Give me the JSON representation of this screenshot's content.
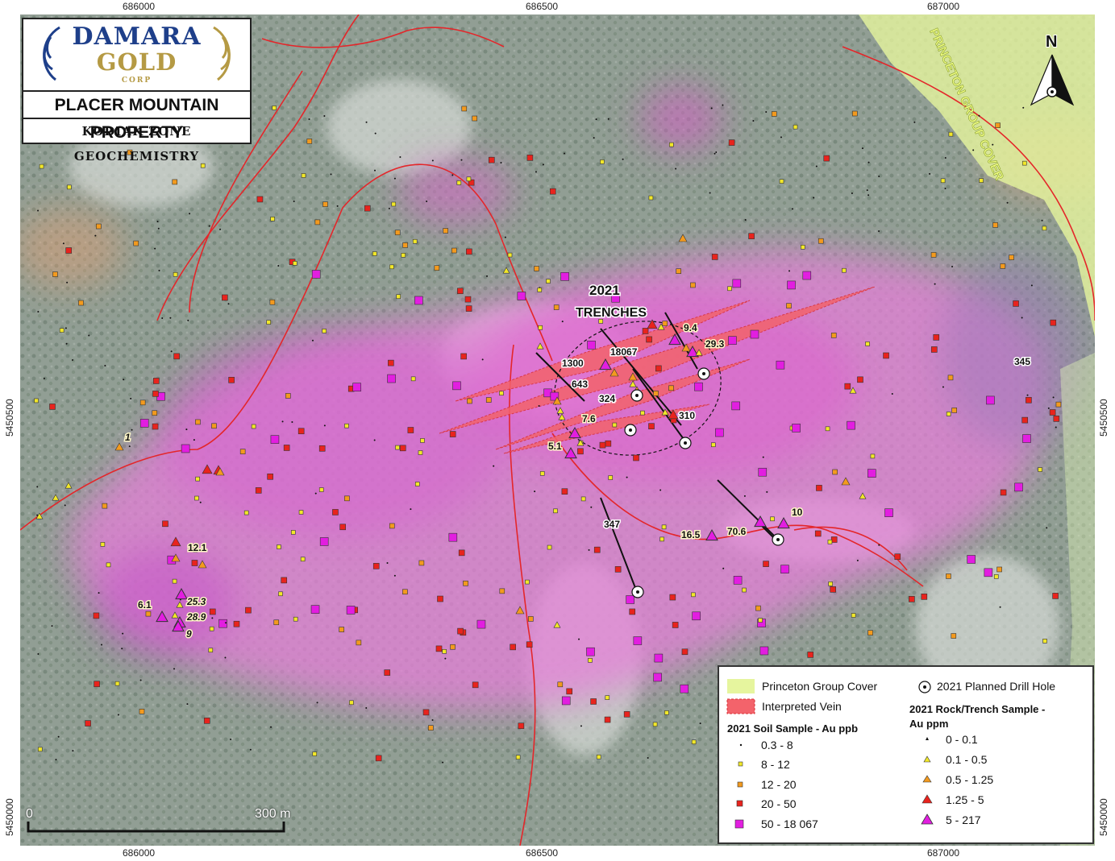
{
  "grid_labels": {
    "top": [
      "686000",
      "686500",
      "687000"
    ],
    "bottom": [
      "686000",
      "686500",
      "687000"
    ],
    "left": [
      "5450500",
      "5450000"
    ],
    "right": [
      "5450500",
      "5450000"
    ]
  },
  "title_box": {
    "logo_line1": "DAMARA",
    "logo_line2": "GOLD",
    "logo_line3": "CORP",
    "property_title": "PLACER MOUNTAIN PROPERTY",
    "zone_title": "KODIAK ZONE GEOCHEMISTRY"
  },
  "north_arrow": {
    "label": "N"
  },
  "map_text": {
    "cover_label": "PRINCETON GROUP COVER",
    "trenches_line1": "2021",
    "trenches_line2": "TRENCHES"
  },
  "sample_labels": [
    "1",
    "12.1",
    "6.1",
    "25.3",
    "28.9",
    "9",
    "1300",
    "18067",
    "643",
    "324",
    "7.6",
    "5.1",
    "310",
    "9.4",
    "29.3",
    "345",
    "347",
    "16.5",
    "70.6",
    "10"
  ],
  "scale_bar": {
    "zero": "0",
    "end": "300 m"
  },
  "legend": {
    "princeton_cover": "Princeton Group Cover",
    "interpreted_vein": "Interpreted Vein",
    "planned_drill_hole": "2021 Planned Drill Hole",
    "soil_heading": "2021 Soil Sample - Au ppb",
    "soil_classes": [
      "0.3 - 8",
      "8 - 12",
      "12 - 20",
      "20 - 50",
      "50 - 18 067"
    ],
    "rock_heading_line1": "2021 Rock/Trench Sample -",
    "rock_heading_line2": "Au ppm",
    "rock_classes": [
      "0 - 0.1",
      "0.1 - 0.5",
      "0.5 - 1.25",
      "1.25 - 5",
      "5 - 217"
    ]
  },
  "colors": {
    "soil_class_1": "#111111",
    "soil_class_2": "#f2e829",
    "soil_class_3": "#f39a1e",
    "soil_class_4": "#e8231d",
    "soil_class_5": "#e21ee0",
    "princeton_cover": "#e6f59e",
    "vein": "#f3636b",
    "road": "#e4262a",
    "anomaly": "#e56fd9"
  }
}
